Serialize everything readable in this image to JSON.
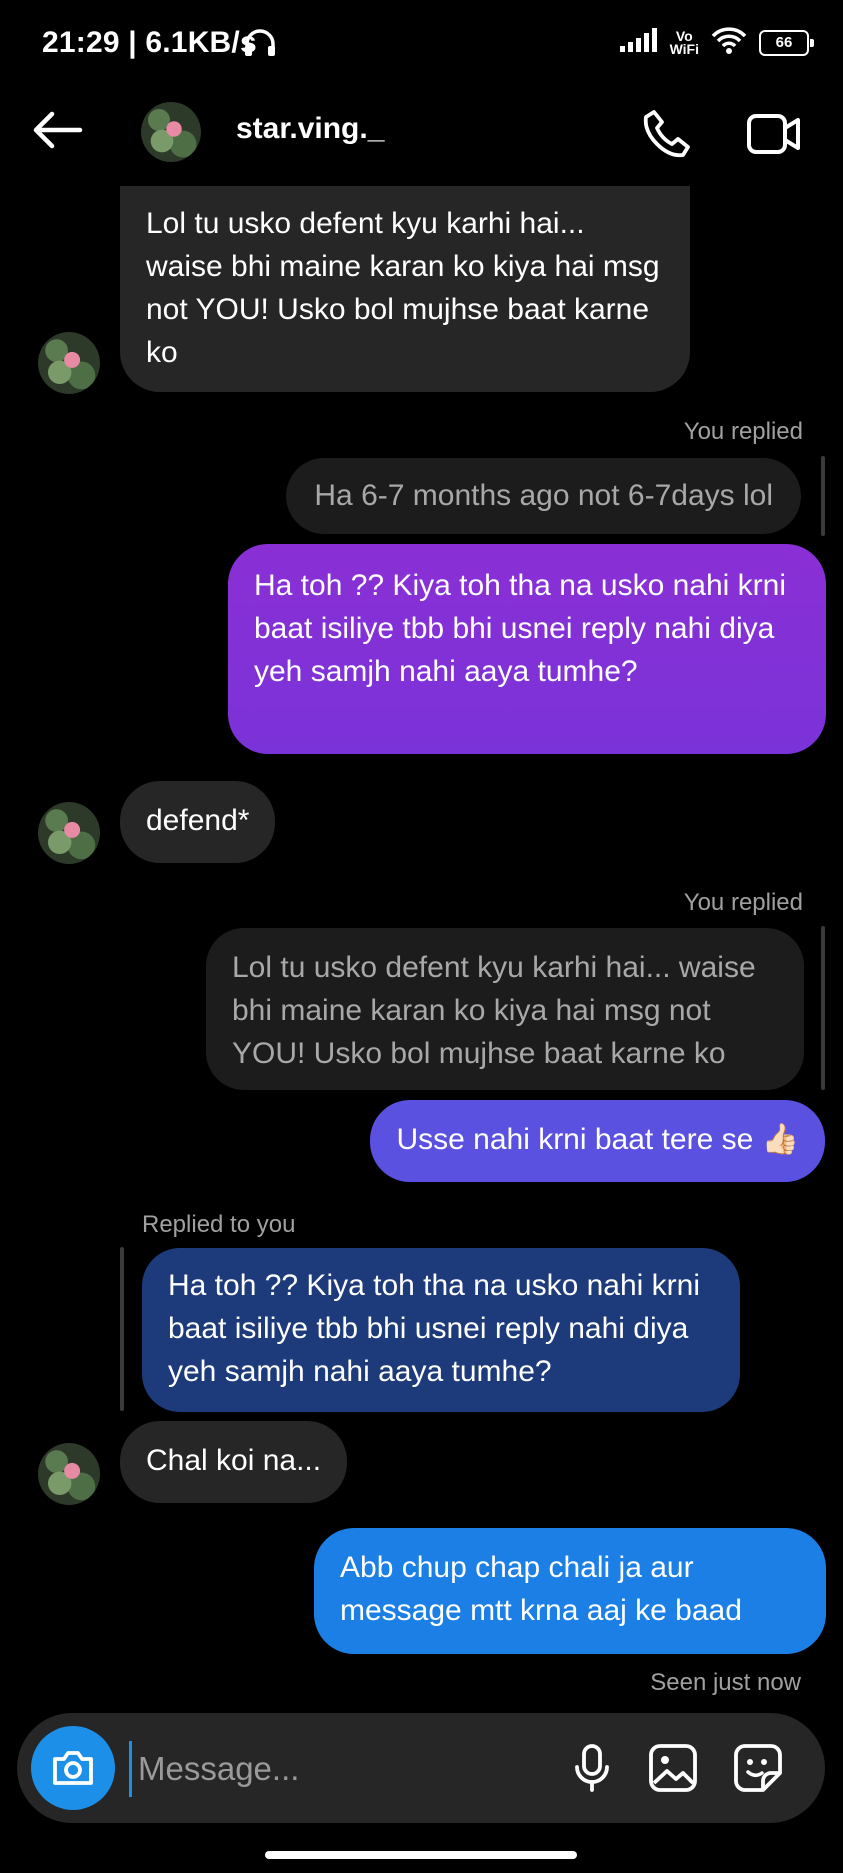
{
  "status_bar": {
    "time_speed": "21:29 | 6.1KB/s",
    "vowifi_top": "Vo",
    "vowifi_bottom": "WiFi",
    "battery": "66"
  },
  "header": {
    "username": "star.ving._"
  },
  "messages": [
    {
      "from": "them",
      "text": "Lol tu usko defent kyu karhi hai... waise bhi maine karan ko kiya hai msg not YOU! Usko bol mujhse baat karne ko"
    },
    {
      "from": "me",
      "reply_label": "You replied",
      "quoted": "Ha 6-7 months ago not 6-7days lol",
      "text": "Ha toh ?? Kiya toh tha na usko nahi krni baat isiliye tbb bhi usnei reply nahi diya yeh samjh nahi aaya tumhe?"
    },
    {
      "from": "them",
      "text": "defend*"
    },
    {
      "from": "me",
      "reply_label": "You replied",
      "quoted": "Lol tu usko defent kyu karhi hai... waise bhi maine karan ko kiya hai msg not YOU! Usko bol mujhse baat karne ko",
      "text": "Usse nahi krni baat tere se 👍🏻"
    },
    {
      "from": "them",
      "reply_label": "Replied to you",
      "quoted": "Ha toh ?? Kiya toh tha na usko nahi krni baat isiliye tbb bhi usnei reply nahi diya yeh samjh nahi aaya tumhe?",
      "text": "Chal koi na..."
    },
    {
      "from": "me",
      "text": "Abb chup chap chali ja aur message mtt krna aaj ke baad"
    }
  ],
  "seen_status": "Seen just now",
  "composer": {
    "placeholder": "Message..."
  },
  "colors": {
    "purple": "#8a2fd6",
    "indigo": "#5b51e0",
    "blue": "#1b7fe6",
    "accent": "#1c8fe9"
  }
}
